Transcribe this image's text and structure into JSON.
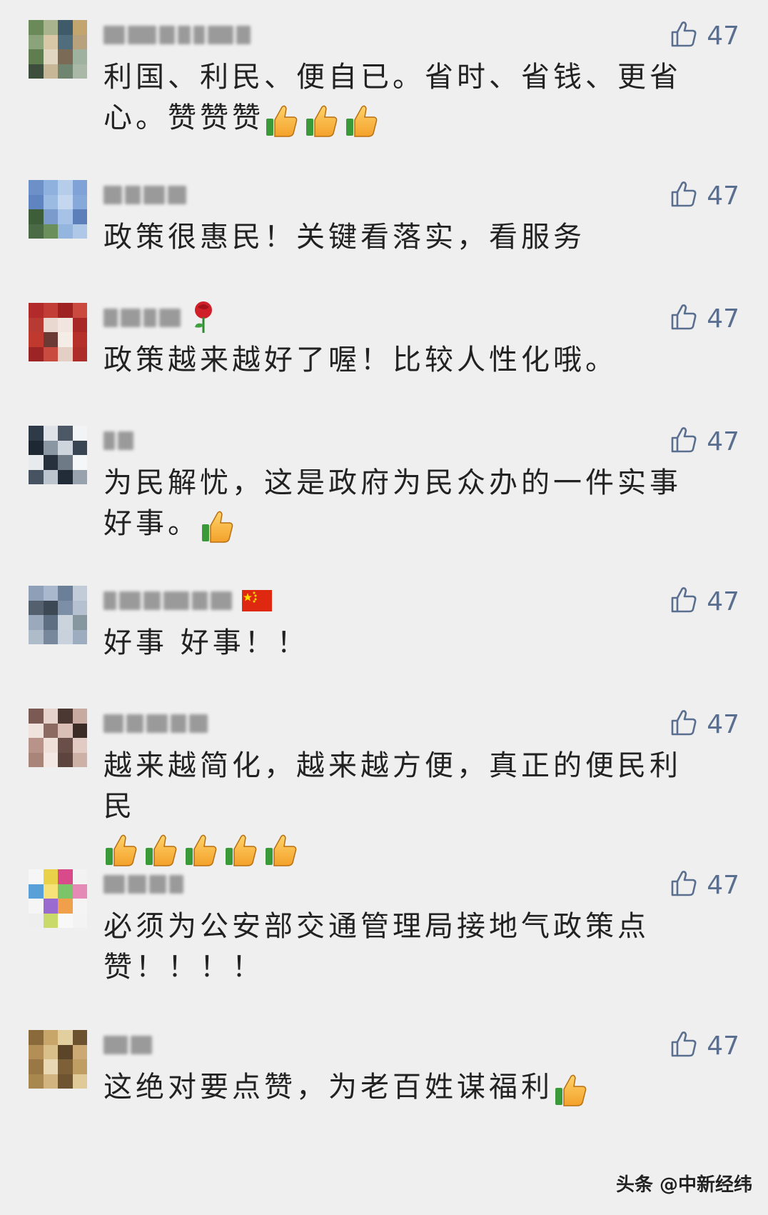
{
  "comments": [
    {
      "text": "利国、利民、便自已。省时、省钱、更省心。赞赞赞",
      "likes": "47",
      "thumbs": 3,
      "thumbs_mode": "inline",
      "name_emoji": "",
      "avatar_colors": [
        "#6b8a5a",
        "#a9b48f",
        "#3f5b6a",
        "#c3a56f",
        "#8aa37a",
        "#d9c8a8",
        "#4f6d7c",
        "#b7a27d",
        "#5f7d4f",
        "#e0d6c2",
        "#7b6a55",
        "#9fb2a0",
        "#3d4f3c",
        "#c7b796",
        "#6f8570",
        "#aab8a8"
      ]
    },
    {
      "text": "政策很惠民！关键看落实，看服务",
      "likes": "47",
      "thumbs": 0,
      "thumbs_mode": "inline",
      "name_emoji": "",
      "avatar_colors": [
        "#6d90c9",
        "#8fb1de",
        "#b6cdea",
        "#7fa3d6",
        "#5f84bf",
        "#9cbbe2",
        "#c4d7ef",
        "#86a9d9",
        "#3e5e3a",
        "#7c9bcd",
        "#a6c2e6",
        "#5c7fb9",
        "#4a6b45",
        "#6a8f5a",
        "#94b6de",
        "#b0c8e8"
      ]
    },
    {
      "text": "政策越来越好了喔！比较人性化哦。",
      "likes": "47",
      "thumbs": 0,
      "thumbs_mode": "inline",
      "name_emoji": "rose",
      "avatar_colors": [
        "#b32a2a",
        "#c23d35",
        "#9e2222",
        "#ca4a40",
        "#b73a33",
        "#e8d8d0",
        "#f1e6df",
        "#a82828",
        "#c0392f",
        "#6b3a35",
        "#f4ece6",
        "#b5302a",
        "#9c2424",
        "#c94a3f",
        "#e3cfc4",
        "#ad2e28"
      ]
    },
    {
      "text": "为民解忧，这是政府为民众办的一件实事好事。",
      "likes": "47",
      "thumbs": 1,
      "thumbs_mode": "inline",
      "name_emoji": "",
      "avatar_colors": [
        "#2f3a48",
        "#dfe3e8",
        "#4d5866",
        "#f1f3f5",
        "#1e2833",
        "#8b96a3",
        "#cfd5dc",
        "#3a4553",
        "#e8ebee",
        "#27313d",
        "#6f7a87",
        "#f5f6f8",
        "#485362",
        "#bcc4cd",
        "#222c38",
        "#97a2ae"
      ]
    },
    {
      "text": "好事 好事！！",
      "likes": "47",
      "thumbs": 0,
      "thumbs_mode": "inline",
      "name_emoji": "flag",
      "avatar_colors": [
        "#8ea0b8",
        "#a9b8cc",
        "#6b7f99",
        "#c2ccd9",
        "#54606d",
        "#3d4855",
        "#7d8fa6",
        "#b5c1d0",
        "#9aa9bc",
        "#5f6f83",
        "#cbd3dd",
        "#87979f",
        "#aebcca",
        "#77889c",
        "#c8d1dc",
        "#9eacbf"
      ]
    },
    {
      "text": "越来越简化，越来越方便，真正的便民利民",
      "likes": "47",
      "thumbs": 5,
      "thumbs_mode": "newline",
      "name_emoji": "",
      "avatar_colors": [
        "#7a5a52",
        "#e6d3cc",
        "#4b3833",
        "#c9aaa0",
        "#f0e2dc",
        "#8d6a61",
        "#d9bfb5",
        "#3c2c28",
        "#b7938a",
        "#efe0da",
        "#6a4f48",
        "#e1cbc3",
        "#a98479",
        "#f3e8e3",
        "#5d443e",
        "#cdb1a7"
      ]
    },
    {
      "text": "必须为公安部交通管理局接地气政策点赞！！！！",
      "likes": "47",
      "thumbs": 0,
      "thumbs_mode": "inline",
      "name_emoji": "",
      "avatar_colors": [
        "#f6f6f6",
        "#e9d24a",
        "#d94a8a",
        "#f2f2f2",
        "#5aa0d8",
        "#f7e27a",
        "#7bc46a",
        "#e58ab7",
        "#f5f5f5",
        "#9b6ad0",
        "#f0a04b",
        "#f4f4f4",
        "#eeeeee",
        "#c9d96a",
        "#f8f8f8",
        "#f3f3f3"
      ]
    },
    {
      "text": "这绝对要点赞，为老百姓谋福利",
      "likes": "47",
      "thumbs": 1,
      "thumbs_mode": "inline",
      "name_emoji": "",
      "avatar_colors": [
        "#8a6a3a",
        "#c8a66a",
        "#e2cfa0",
        "#6d5230",
        "#b38f57",
        "#d9bf8a",
        "#5c4428",
        "#caa975",
        "#9a7845",
        "#e8d8b4",
        "#7d6038",
        "#bf9d63",
        "#a9884f",
        "#d1b47f",
        "#6f5432",
        "#e0ca98"
      ]
    }
  ],
  "watermark": "头条 @中新经纬",
  "colors": {
    "like": "#5a6f8f",
    "text": "#222222",
    "background": "#efefef"
  }
}
